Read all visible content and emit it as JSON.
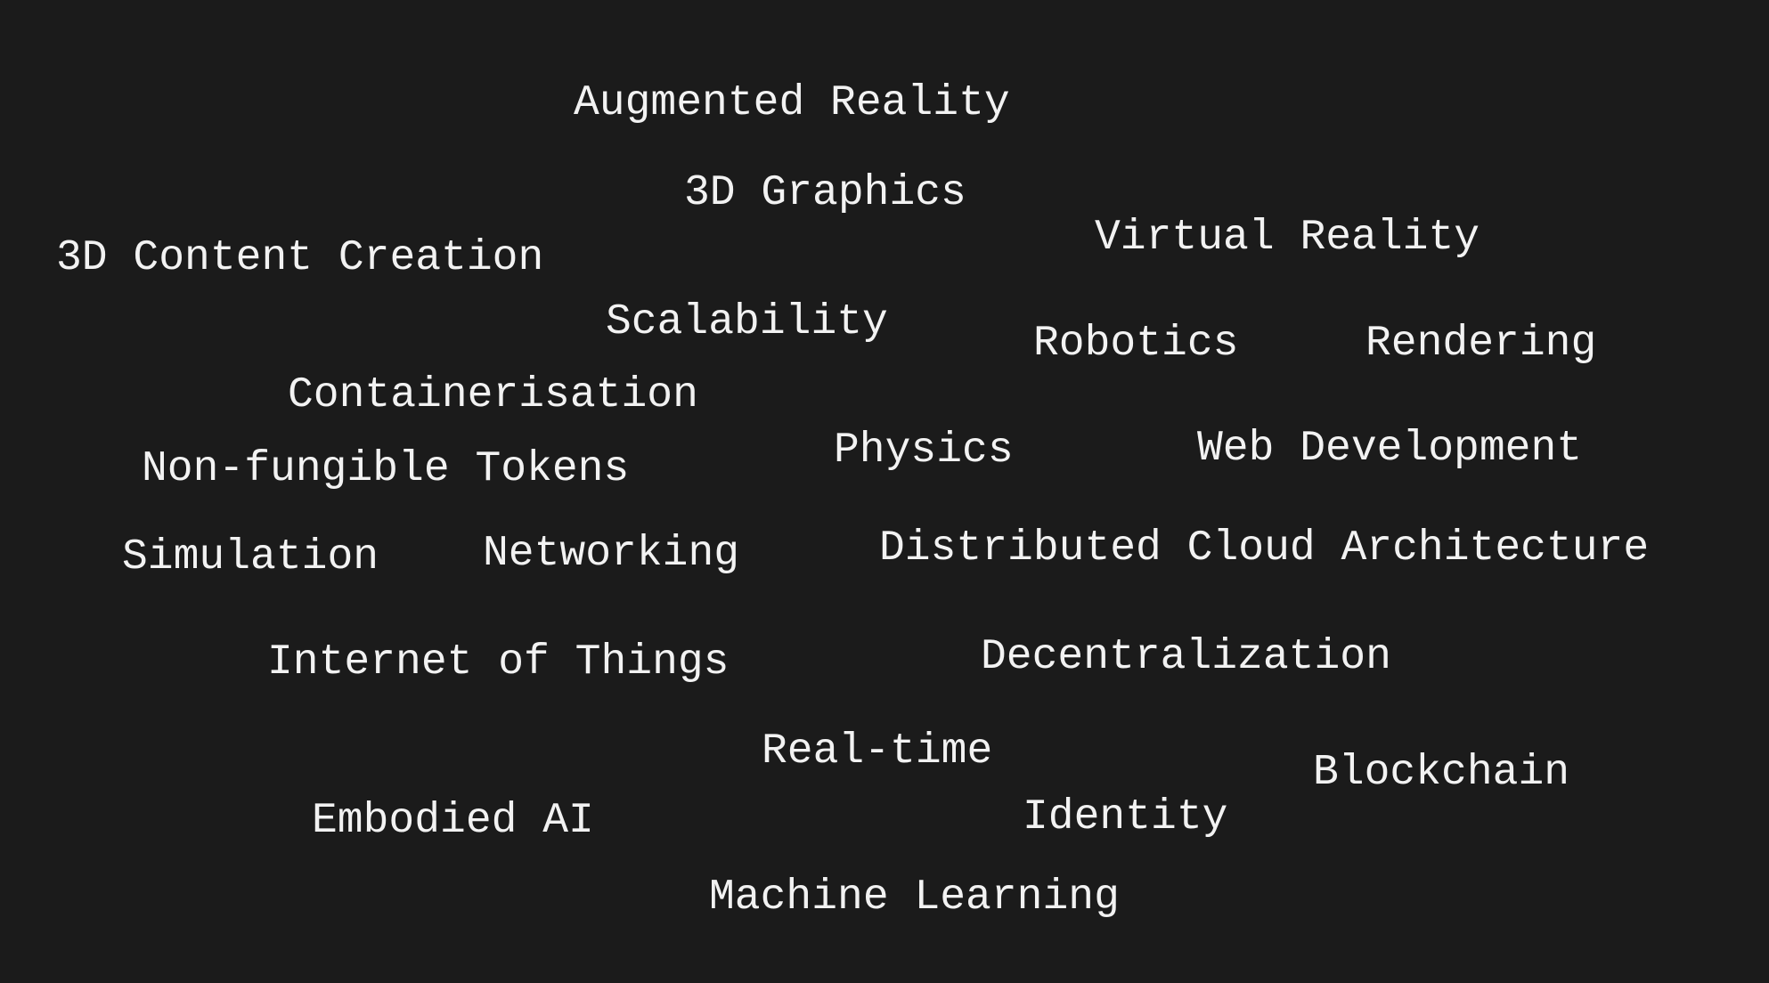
{
  "background_color": "#1b1b1b",
  "text_color": "#f2f2f2",
  "terms": {
    "augmented_reality": "Augmented Reality",
    "graphics_3d": "3D Graphics",
    "virtual_reality": "Virtual Reality",
    "content_creation_3d": "3D Content Creation",
    "scalability": "Scalability",
    "robotics": "Robotics",
    "rendering": "Rendering",
    "containerisation": "Containerisation",
    "physics": "Physics",
    "web_development": "Web Development",
    "non_fungible_tokens": "Non-fungible Tokens",
    "simulation": "Simulation",
    "networking": "Networking",
    "distributed_cloud_architecture": "Distributed Cloud Architecture",
    "internet_of_things": "Internet of Things",
    "decentralization": "Decentralization",
    "real_time": "Real-time",
    "blockchain": "Blockchain",
    "embodied_ai": "Embodied AI",
    "identity": "Identity",
    "machine_learning": "Machine Learning"
  }
}
